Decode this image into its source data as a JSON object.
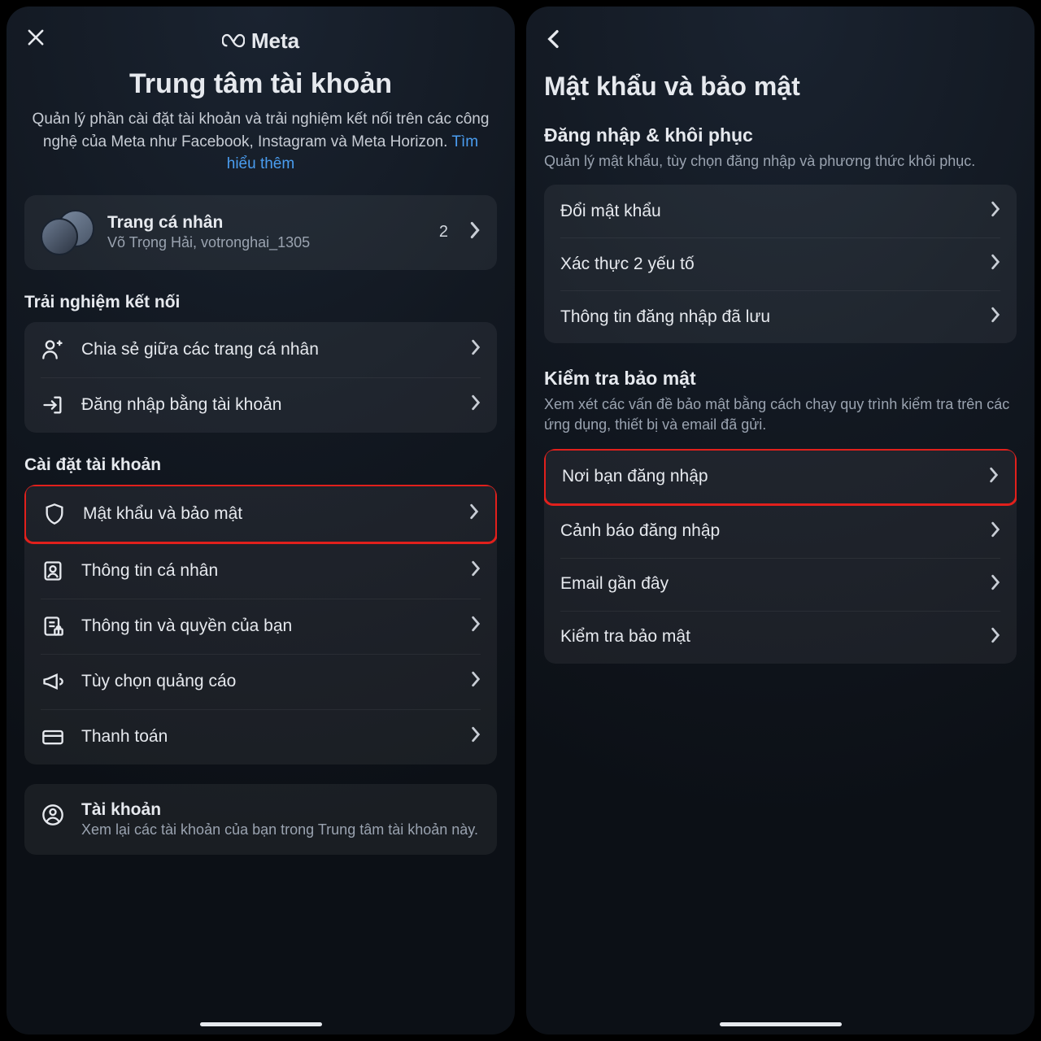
{
  "left": {
    "brand": "Meta",
    "title": "Trung tâm tài khoản",
    "desc_pre": "Quản lý phần cài đặt tài khoản và trải nghiệm kết nối trên các công nghệ của Meta như Facebook, Instagram và Meta Horizon. ",
    "desc_link": "Tìm hiểu thêm",
    "profile": {
      "title": "Trang cá nhân",
      "sub": "Võ Trọng Hải, votronghai_1305",
      "count": "2"
    },
    "sec1_head": "Trải nghiệm kết nối",
    "sec1": {
      "share": "Chia sẻ giữa các trang cá nhân",
      "login": "Đăng nhập bằng tài khoản"
    },
    "sec2_head": "Cài đặt tài khoản",
    "sec2": {
      "pw": "Mật khẩu và bảo mật",
      "pers": "Thông tin cá nhân",
      "rights": "Thông tin và quyền của bạn",
      "ads": "Tùy chọn quảng cáo",
      "pay": "Thanh toán"
    },
    "sec3": {
      "acc_title": "Tài khoản",
      "acc_sub": "Xem lại các tài khoản của bạn trong Trung tâm tài khoản này."
    }
  },
  "right": {
    "title": "Mật khẩu và bảo mật",
    "g1_head": "Đăng nhập & khôi phục",
    "g1_desc": "Quản lý mật khẩu, tùy chọn đăng nhập và phương thức khôi phục.",
    "g1": {
      "chpw": "Đổi mật khẩu",
      "twofa": "Xác thực 2 yếu tố",
      "saved": "Thông tin đăng nhập đã lưu"
    },
    "g2_head": "Kiểm tra bảo mật",
    "g2_desc": "Xem xét các vấn đề bảo mật bằng cách chạy quy trình kiểm tra trên các ứng dụng, thiết bị và email đã gửi.",
    "g2": {
      "where": "Nơi bạn đăng nhập",
      "alerts": "Cảnh báo đăng nhập",
      "emails": "Email gần đây",
      "check": "Kiểm tra bảo mật"
    }
  }
}
